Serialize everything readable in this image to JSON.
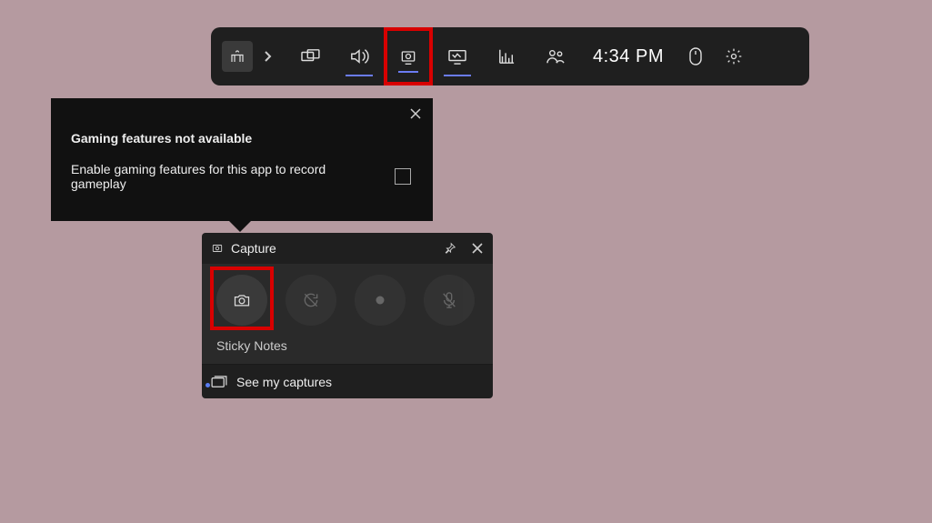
{
  "toolbar": {
    "time": "4:34 PM"
  },
  "tooltip": {
    "title": "Gaming features not available",
    "message": "Enable gaming features for this app to record gameplay"
  },
  "capture": {
    "title": "Capture",
    "app_name": "Sticky Notes",
    "see_captures": "See my captures"
  }
}
